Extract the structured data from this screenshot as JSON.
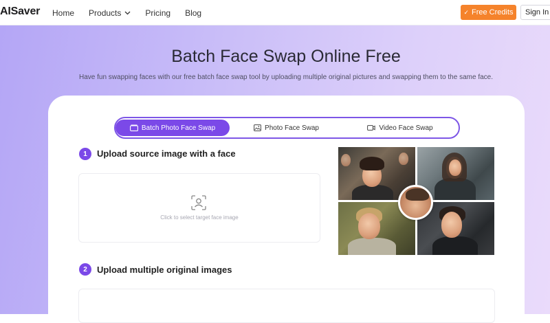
{
  "nav": {
    "logo": "AISaver",
    "links": [
      "Home",
      "Products",
      "Pricing",
      "Blog"
    ],
    "free_credits": "Free Credits",
    "sign_in": "Sign In"
  },
  "hero": {
    "title": "Batch Face Swap Online Free",
    "subtitle": "Have fun swapping faces with our free batch face swap tool by uploading multiple original pictures and swapping them to the same face."
  },
  "tabs": [
    {
      "label": "Batch Photo Face Swap",
      "icon": "batch-photo-icon",
      "active": true
    },
    {
      "label": "Photo Face Swap",
      "icon": "photo-icon",
      "active": false
    },
    {
      "label": "Video Face Swap",
      "icon": "video-icon",
      "active": false
    }
  ],
  "steps": [
    {
      "number": "1",
      "title": "Upload source image with a face",
      "hint": "Click to select target face image"
    },
    {
      "number": "2",
      "title": "Upload multiple original images"
    }
  ],
  "colors": {
    "accent": "#7b49e8",
    "credits": "#f5832b"
  }
}
